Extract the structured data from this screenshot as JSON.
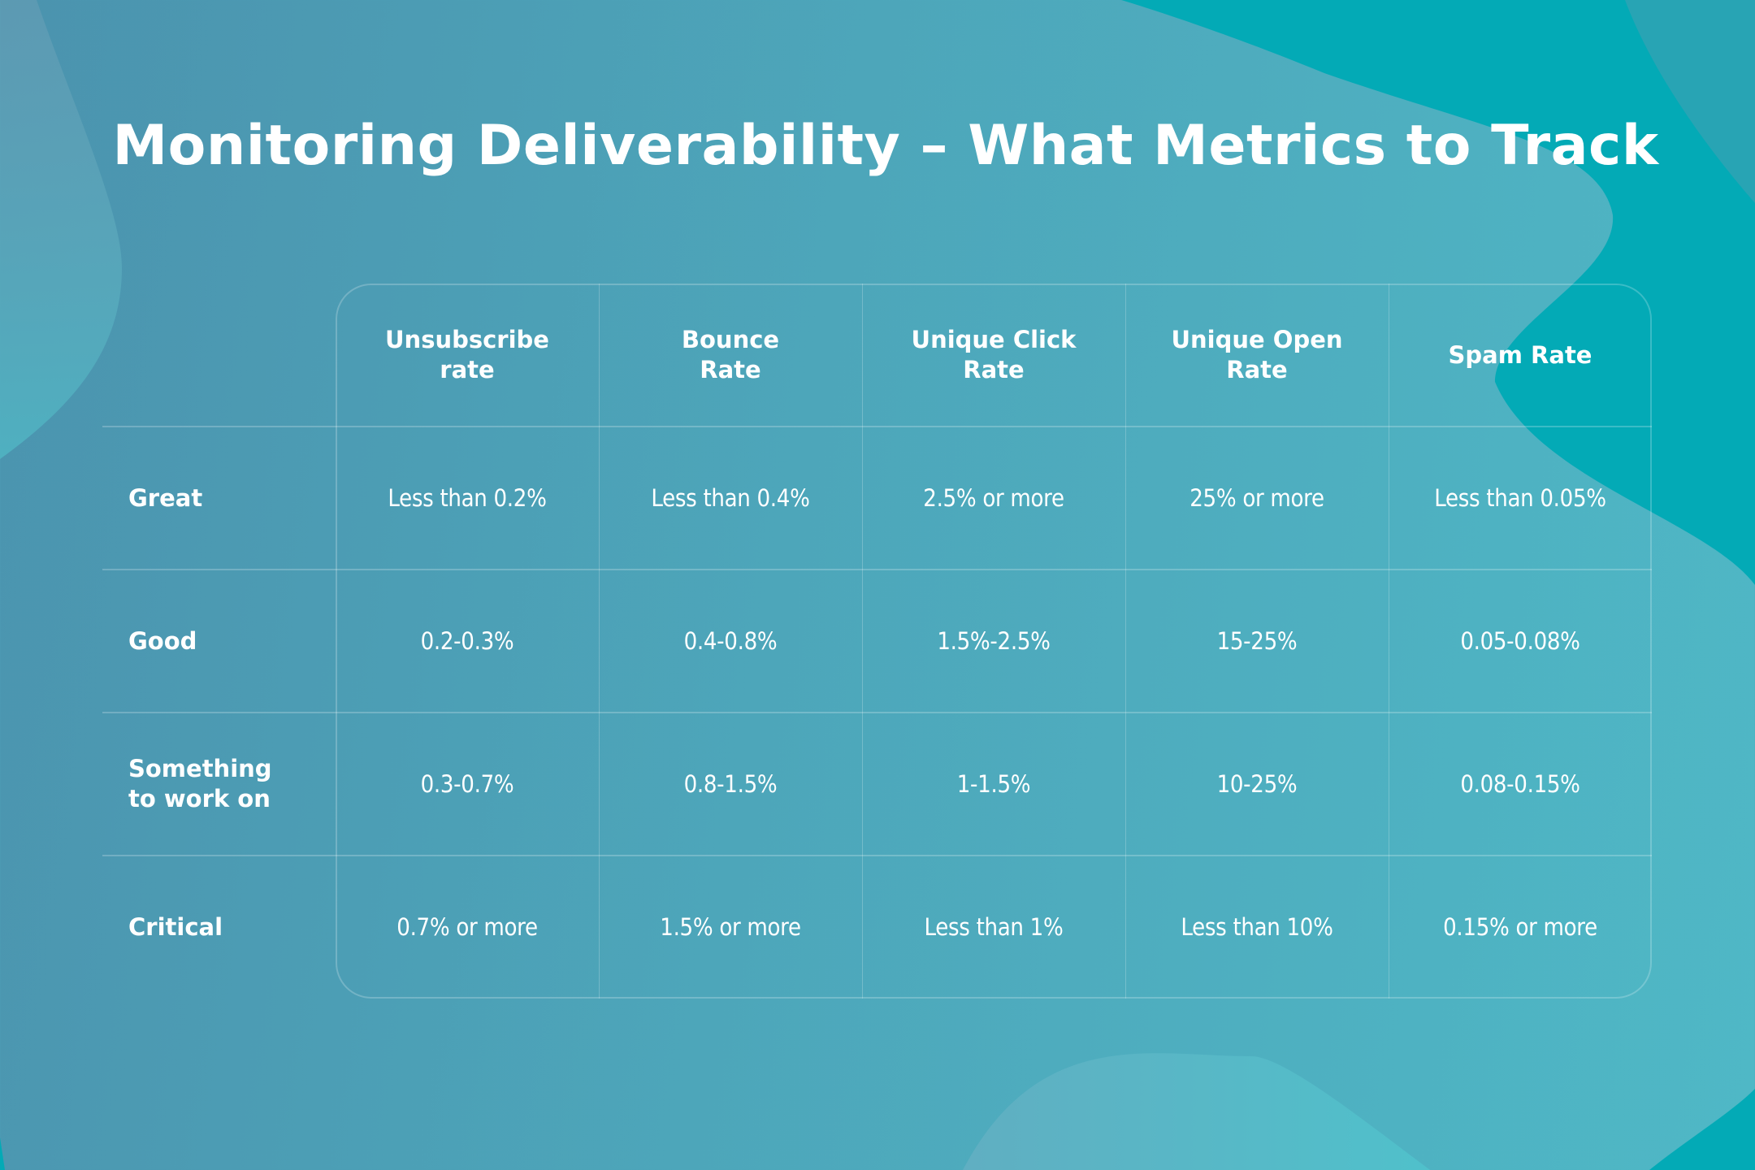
{
  "title": "Monitoring Deliverability – What Metrics to Track",
  "colors": {
    "background_left": "#4B93AE",
    "background_right": "#4FB8C6",
    "accent_teal": "#03AAB6",
    "text": "#FFFFFF",
    "grid_line": "rgba(255,255,255,0.22)"
  },
  "table": {
    "columns": [
      {
        "line1": "Unsubscribe",
        "line2": "rate"
      },
      {
        "line1": "Bounce",
        "line2": "Rate"
      },
      {
        "line1": "Unique Click",
        "line2": "Rate"
      },
      {
        "line1": "Unique Open",
        "line2": "Rate"
      },
      {
        "line1": "Spam Rate",
        "line2": ""
      }
    ],
    "rows": [
      {
        "label_line1": "Great",
        "label_line2": "",
        "values": [
          "Less than 0.2%",
          "Less than 0.4%",
          "2.5% or more",
          "25% or more",
          "Less than 0.05%"
        ]
      },
      {
        "label_line1": "Good",
        "label_line2": "",
        "values": [
          "0.2-0.3%",
          "0.4-0.8%",
          "1.5%-2.5%",
          "15-25%",
          "0.05-0.08%"
        ]
      },
      {
        "label_line1": "Something",
        "label_line2": "to work on",
        "values": [
          "0.3-0.7%",
          "0.8-1.5%",
          "1-1.5%",
          "10-25%",
          "0.08-0.15%"
        ]
      },
      {
        "label_line1": "Critical",
        "label_line2": "",
        "values": [
          "0.7% or more",
          "1.5% or more",
          "Less than 1%",
          "Less than 10%",
          "0.15% or more"
        ]
      }
    ]
  }
}
